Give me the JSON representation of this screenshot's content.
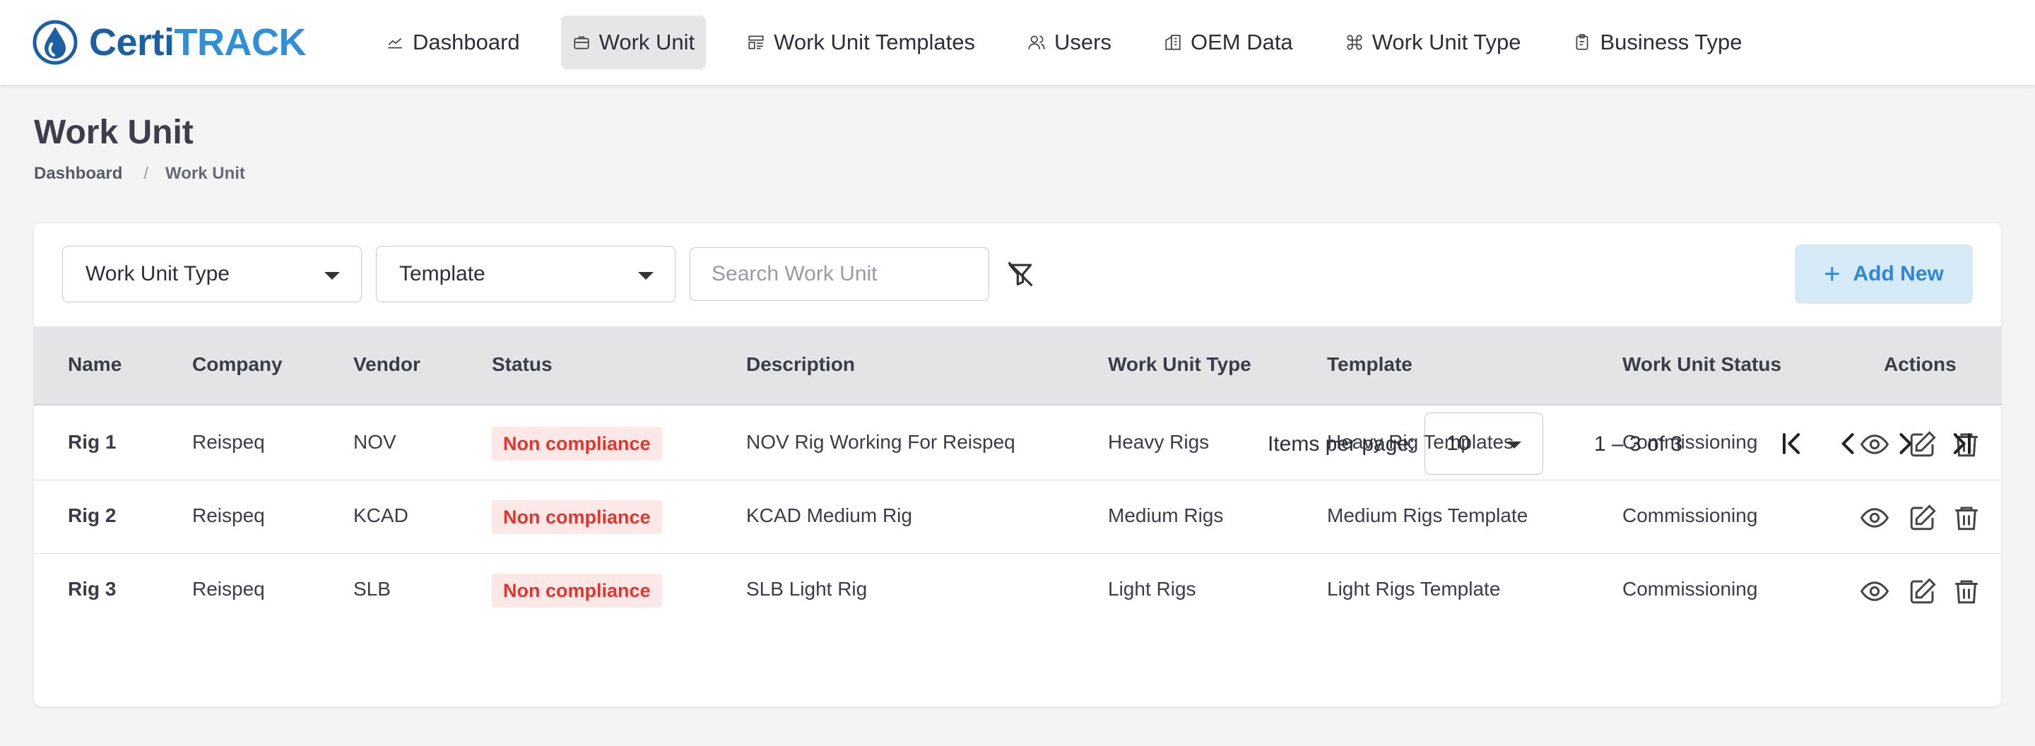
{
  "brand": {
    "part1": "Certi",
    "part2": "TRACK"
  },
  "nav": [
    {
      "label": "Dashboard",
      "icon": "chart-icon"
    },
    {
      "label": "Work Unit",
      "icon": "briefcase-icon",
      "active": true
    },
    {
      "label": "Work Unit Templates",
      "icon": "template-icon"
    },
    {
      "label": "Users",
      "icon": "users-icon"
    },
    {
      "label": "OEM Data",
      "icon": "building-icon"
    },
    {
      "label": "Work Unit Type",
      "icon": "command-icon"
    },
    {
      "label": "Business Type",
      "icon": "clipboard-icon"
    }
  ],
  "page": {
    "title": "Work Unit",
    "breadcrumb": [
      "Dashboard",
      "Work Unit"
    ]
  },
  "filters": {
    "type_select": "Work Unit Type",
    "template_select": "Template",
    "search_placeholder": "Search Work Unit",
    "add_label": "Add New"
  },
  "table": {
    "headers": [
      "Name",
      "Company",
      "Vendor",
      "Status",
      "Description",
      "Work Unit Type",
      "Template",
      "Work Unit Status",
      "Actions"
    ],
    "rows": [
      {
        "name": "Rig 1",
        "company": "Reispeq",
        "vendor": "NOV",
        "status": "Non compliance",
        "description": "NOV Rig Working For Reispeq",
        "type": "Heavy Rigs",
        "template": "Heavy Rig Templates",
        "unit_status": "Commissioning"
      },
      {
        "name": "Rig 2",
        "company": "Reispeq",
        "vendor": "KCAD",
        "status": "Non compliance",
        "description": "KCAD Medium Rig",
        "type": "Medium Rigs",
        "template": "Medium Rigs Template",
        "unit_status": "Commissioning"
      },
      {
        "name": "Rig 3",
        "company": "Reispeq",
        "vendor": "SLB",
        "status": "Non compliance",
        "description": "SLB Light Rig",
        "type": "Light Rigs",
        "template": "Light Rigs Template",
        "unit_status": "Commissioning"
      }
    ]
  },
  "pagination": {
    "items_label": "Items per page:",
    "page_size": "10",
    "range": "1 – 3 of 3"
  },
  "colors": {
    "brand_dark": "#1d5fa3",
    "brand_light": "#2f8fd8",
    "badge_text": "#e0362f",
    "badge_bg": "#fde8e8",
    "add_bg": "#d6eaf8"
  }
}
